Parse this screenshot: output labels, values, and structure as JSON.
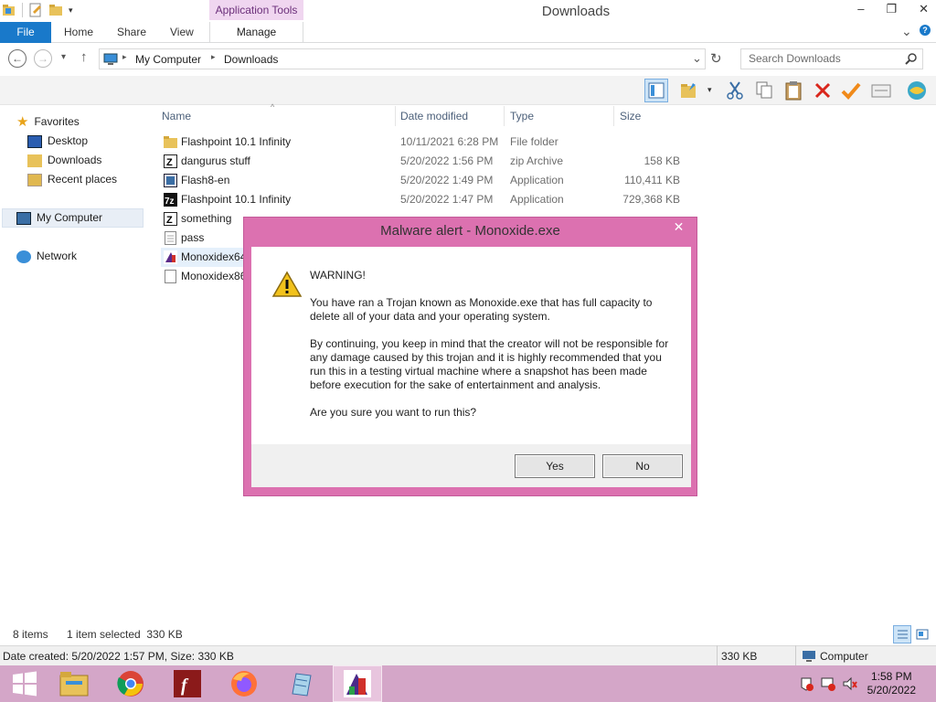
{
  "window": {
    "title": "Downloads",
    "context_tab": "Application Tools",
    "minimize": "–",
    "maximize": "❐",
    "close": "✕"
  },
  "ribbon": {
    "file": "File",
    "tabs": [
      "Home",
      "Share",
      "View"
    ],
    "manage": "Manage",
    "expand": "⌄"
  },
  "address": {
    "back": "←",
    "forward": "→",
    "recent": "▾",
    "up": "↑",
    "crumbs": [
      "My Computer",
      "Downloads"
    ],
    "refresh": "↻",
    "dropdown": "⌄",
    "search_placeholder": "Search Downloads"
  },
  "nav": {
    "favorites": "Favorites",
    "desktop": "Desktop",
    "downloads": "Downloads",
    "recent": "Recent places",
    "computer": "My Computer",
    "network": "Network"
  },
  "columns": {
    "name": "Name",
    "date": "Date modified",
    "type": "Type",
    "size": "Size"
  },
  "files": [
    {
      "name": "Flashpoint 10.1 Infinity",
      "date": "10/11/2021 6:28 PM",
      "type": "File folder",
      "size": "",
      "icon": "folder-icon"
    },
    {
      "name": "dangurus stuff",
      "date": "5/20/2022 1:56 PM",
      "type": "zip Archive",
      "size": "158 KB",
      "icon": "zip-icon"
    },
    {
      "name": "Flash8-en",
      "date": "5/20/2022 1:49 PM",
      "type": "Application",
      "size": "110,411 KB",
      "icon": "installer-icon"
    },
    {
      "name": "Flashpoint 10.1 Infinity",
      "date": "5/20/2022 1:47 PM",
      "type": "Application",
      "size": "729,368 KB",
      "icon": "7z-icon"
    },
    {
      "name": "something",
      "date": "",
      "type": "",
      "size": "",
      "icon": "zip-icon"
    },
    {
      "name": "pass",
      "date": "",
      "type": "",
      "size": "",
      "icon": "text-file-icon"
    },
    {
      "name": "Monoxidex64",
      "date": "",
      "type": "",
      "size": "",
      "icon": "exe-icon"
    },
    {
      "name": "Monoxidex86",
      "date": "",
      "type": "",
      "size": "",
      "icon": "blank-file-icon"
    }
  ],
  "status": {
    "items": "8 items",
    "selected": "1 item selected  330 KB",
    "info": "Date created: 5/20/2022 1:57 PM, Size: 330 KB",
    "size": "330 KB",
    "location": "Computer"
  },
  "dialog": {
    "title": "Malware alert - Monoxide.exe",
    "close": "✕",
    "heading": "WARNING!",
    "p1": "You have ran a Trojan known as Monoxide.exe that has full capacity to delete all of your data and your operating system.",
    "p2": "By continuing, you keep in mind that the creator will not be responsible for any damage caused by this trojan and it is highly recommended that you run this in a testing virtual machine where a snapshot has been made before execution for the sake of entertainment and analysis.",
    "p3": "Are you sure you want to run this?",
    "yes": "Yes",
    "no": "No"
  },
  "taskbar": {
    "time": "1:58 PM",
    "date": "5/20/2022"
  },
  "colors": {
    "accent": "#1979ca",
    "dialog_border": "#dc71b0",
    "taskbar": "#d4a6c8"
  }
}
